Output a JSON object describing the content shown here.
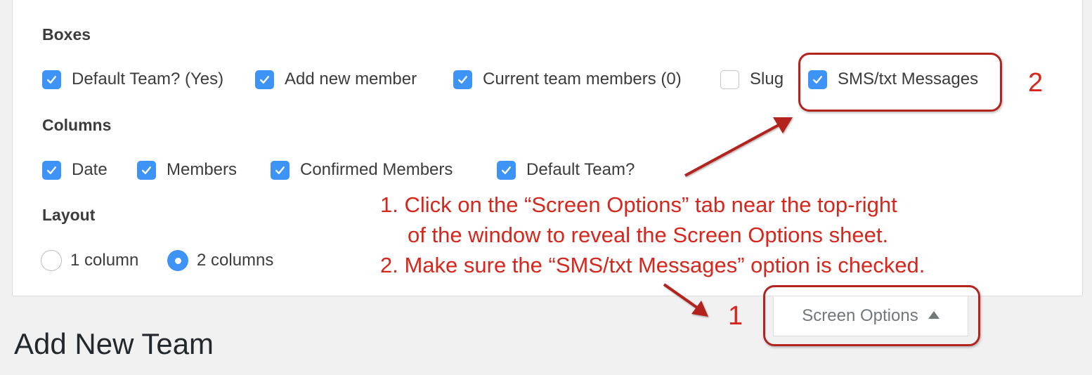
{
  "screen_options": {
    "boxes": {
      "heading": "Boxes",
      "items": [
        {
          "label": "Default Team? (Yes)",
          "checked": true
        },
        {
          "label": "Add new member",
          "checked": true
        },
        {
          "label": "Current team members (0)",
          "checked": true
        },
        {
          "label": "Slug",
          "checked": false
        },
        {
          "label": "SMS/txt Messages",
          "checked": true
        }
      ]
    },
    "columns": {
      "heading": "Columns",
      "items": [
        {
          "label": "Date",
          "checked": true
        },
        {
          "label": "Members",
          "checked": true
        },
        {
          "label": "Confirmed Members",
          "checked": true
        },
        {
          "label": "Default Team?",
          "checked": true
        }
      ]
    },
    "layout": {
      "heading": "Layout",
      "options": [
        {
          "label": "1 column",
          "selected": false
        },
        {
          "label": "2 columns",
          "selected": true
        }
      ]
    }
  },
  "screen_options_tab": {
    "label": "Screen Options",
    "icon": "triangle-up-icon"
  },
  "page": {
    "title": "Add New Team"
  },
  "annotations": {
    "color": "#d7261c",
    "box_color": "#b3241e",
    "marker_1": "1",
    "marker_2": "2",
    "instructions": [
      "1. Click on the “Screen Options” tab near the top-right",
      "of the window to reveal the Screen Options sheet.",
      "2. Make sure the “SMS/txt Messages” option is checked."
    ]
  }
}
